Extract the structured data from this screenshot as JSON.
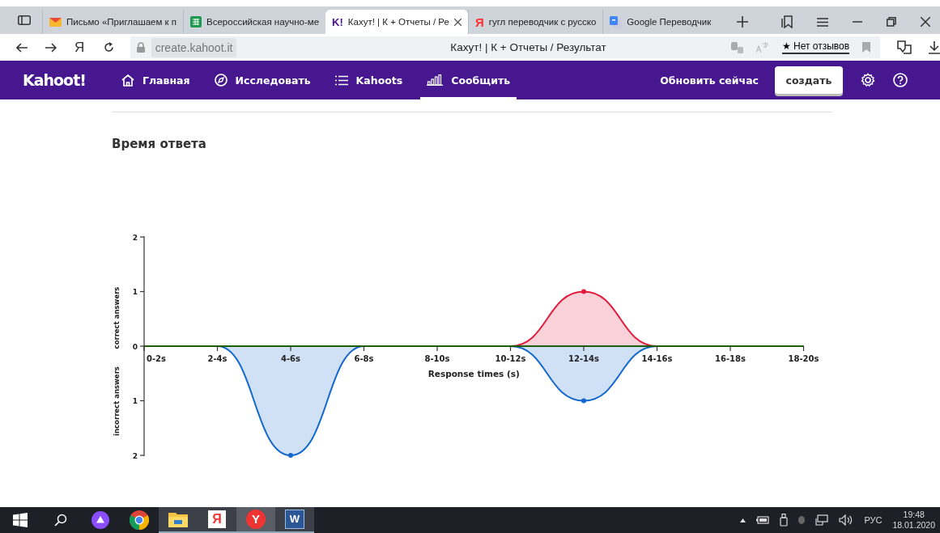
{
  "browser": {
    "tabs": [
      {
        "kind": "mail",
        "label": "Письмо «Приглашаем к п",
        "selected": false
      },
      {
        "kind": "sheet",
        "label": "Всероссийская научно-ме",
        "selected": false
      },
      {
        "kind": "kahoot",
        "icon_text": "K!",
        "label": "Кахут! | К + Отчеты / Ре",
        "selected": true
      },
      {
        "kind": "yandex",
        "icon_text": "Я",
        "label": "гугл переводчик с русско",
        "selected": false
      },
      {
        "kind": "translate",
        "label": "Google Переводчик",
        "selected": false
      }
    ],
    "nav_letter": "Я",
    "url": "create.kahoot.it",
    "page_title": "Кахут! | К + Отчеты / Результат",
    "reviews": "★ Нет отзывов"
  },
  "app": {
    "logo": "Kahoot!",
    "nav": [
      {
        "kind": "home",
        "label": "Главная",
        "selected": false
      },
      {
        "kind": "compass",
        "label": "Исследовать",
        "selected": false
      },
      {
        "kind": "list",
        "label": "Kahoots",
        "selected": false
      },
      {
        "kind": "bars",
        "label": "Сообщить",
        "selected": true
      }
    ],
    "upgrade": "Обновить сейчас",
    "create": "создать"
  },
  "section": {
    "title": "Время ответа",
    "chart_data": {
      "type": "area",
      "xlabel": "Response times (s)",
      "ylabel": "correct answers",
      "annotations": [
        {
          "text": "incorrect answers"
        }
      ],
      "categories": [
        "0-2s",
        "2-4s",
        "4-6s",
        "6-8s",
        "8-10s",
        "10-12s",
        "12-14s",
        "14-16s",
        "16-18s",
        "18-20s"
      ],
      "ylim": [
        -2,
        2
      ],
      "yticks": [
        {
          "value": 2,
          "label": "2"
        },
        {
          "value": 1,
          "label": "1"
        },
        {
          "value": 0,
          "label": "0"
        },
        {
          "value": -1,
          "label": "1"
        },
        {
          "value": -2,
          "label": "2"
        }
      ],
      "series": [
        {
          "color": "#e21b3c",
          "values": [
            0,
            0,
            0,
            0,
            0,
            0,
            1,
            0,
            0,
            0
          ]
        },
        {
          "color": "#1368ce",
          "values": [
            0,
            0,
            -2,
            0,
            0,
            0,
            -1,
            0,
            0,
            0
          ]
        }
      ]
    }
  },
  "taskbar": {
    "apps": [
      {
        "kind": "alice",
        "open": false,
        "selected": false
      },
      {
        "kind": "chrome",
        "open": false,
        "selected": false
      },
      {
        "kind": "explorer",
        "open": true,
        "selected": false
      },
      {
        "kind": "yandex",
        "icon_text": "Я",
        "open": true,
        "selected": false
      },
      {
        "kind": "ybrowser",
        "icon_text": "Y",
        "open": true,
        "selected": true
      },
      {
        "kind": "word",
        "icon_text": "W",
        "open": true,
        "selected": false
      }
    ],
    "language": "РУС",
    "time": "19:48",
    "date": "18.01.2020"
  }
}
